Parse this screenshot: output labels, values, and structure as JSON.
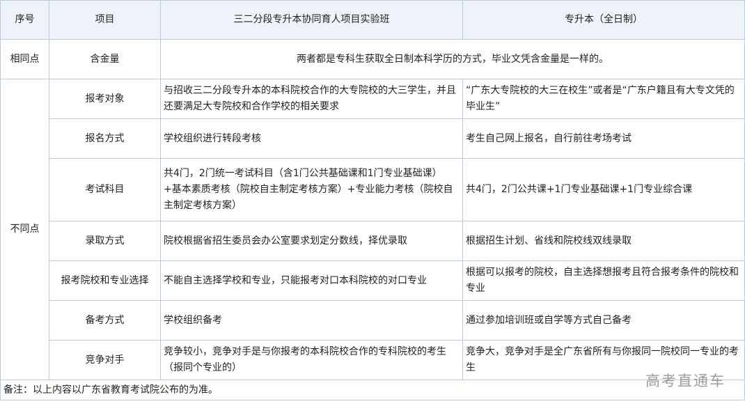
{
  "header": {
    "col_index": "序号",
    "col_item": "项目",
    "col_program_a": "三二分段专升本协同育人项目实验班",
    "col_program_b": "专升本（全日制）"
  },
  "same": {
    "group_label": "相同点",
    "item": "含金量",
    "text": "两者都是专科生获取全日制本科学历的方式，毕业文凭含金量是一样的。"
  },
  "diff": {
    "group_label": "不同点",
    "rows": [
      {
        "item": "报考对象",
        "a": "与招收三二分段专升本的本科院校合作的大专院校的大三学生，并且还要满足大专院校和合作学校的相关要求",
        "b": "“广东大专院校的大三在校生”或者是“广东户籍且有大专文凭的毕业生”"
      },
      {
        "item": "报名方式",
        "a": "学校组织进行转段考核",
        "b": "考生自己网上报名，自行前往考场考试"
      },
      {
        "item": "考试科目",
        "a": "共4门，2门统一考试科目（含1门公共基础课和1门专业基础课）+基本素质考核（院校自主制定考核方案）+专业能力考核（院校自主制定考核方案）",
        "b": "共4门，2门公共课+1门专业基础课+1门专业综合课"
      },
      {
        "item": "录取方式",
        "a": "院校根据省招生委员会办公室要求划定分数线，择优录取",
        "b": "根据招生计划、省线和院校线双线录取"
      },
      {
        "item": "报考院校和专业选择",
        "a": "不能自主选择学校和专业，只能报考对口本科院校的对口专业",
        "b": "根据可以报考的院校，自主选择想报考且符合报考条件的院校和专业"
      },
      {
        "item": "备考方式",
        "a": "学校组织备考",
        "b": "通过参加培训班或自学等方式自己备考"
      },
      {
        "item": "竞争对手",
        "a": "竞争较小，竞争对手是与你报考的本科院校合作的专科院校的考生（报同个专业的）",
        "b": "竞争大，竞争对手是全广东省所有与你报同一院校同一专业的考生"
      }
    ]
  },
  "footnote": "备注：以上内容以广东省教育考试院公布的为准。",
  "watermark": "高考直通车"
}
